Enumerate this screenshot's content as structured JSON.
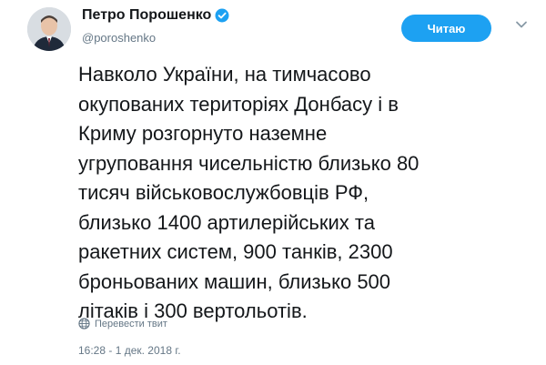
{
  "author": {
    "display_name": "Петро Порошенко",
    "handle": "@poroshenko",
    "verified": true,
    "verified_icon": "verified-badge-icon",
    "avatar_icon": "avatar-photo"
  },
  "actions": {
    "follow_label": "Читаю",
    "menu_icon": "chevron-down-icon"
  },
  "tweet": {
    "lines": [
      "Навколо України, на тимчасово",
      "окупованих територіях Донбасу і в",
      "Криму розгорнуто наземне",
      "угруповання чисельністю близько 80",
      "тисяч військовослужбовців РФ,",
      "близько 1400 артилерійських та",
      "ракетних систем, 900 танків, 2300",
      "броньованих машин, близько 500",
      "літаків і 300 вертольотів."
    ],
    "translate_label": "Перевести твит",
    "translate_icon": "globe-icon",
    "timestamp": "16:28 - 1 дек. 2018 г."
  },
  "colors": {
    "accent": "#1da1f2",
    "text": "#14171a",
    "muted": "#657786"
  }
}
